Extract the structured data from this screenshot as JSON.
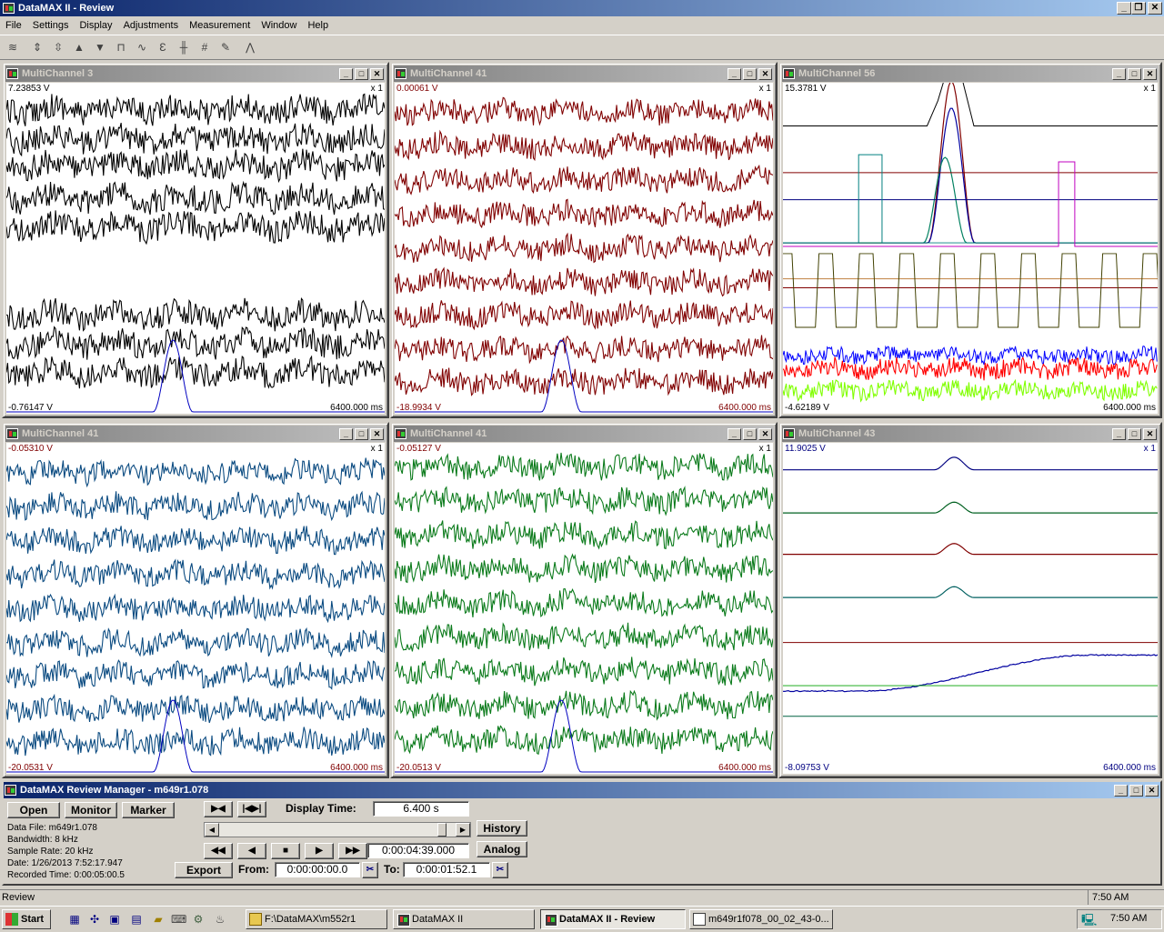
{
  "app": {
    "title": "DataMAX II - Review"
  },
  "menu": [
    "File",
    "Settings",
    "Display",
    "Adjustments",
    "Measurement",
    "Window",
    "Help"
  ],
  "toolbar_icons": [
    "waveform-icon",
    "zoom-in-vertical-icon",
    "zoom-out-vertical-icon",
    "arrow-up-icon",
    "arrow-down-icon",
    "chart-icon",
    "signal-icon",
    "eu-icon",
    "channel-icon",
    "grid-icon",
    "pen-icon",
    "trace-icon"
  ],
  "panels": [
    {
      "title": "MultiChannel 3",
      "top_value": "7.23853 V",
      "bottom_value": "-0.76147 V",
      "scale": "x 1",
      "time": "6400.000 ms",
      "color": "#000000"
    },
    {
      "title": "MultiChannel 41",
      "top_value": "0.00061 V",
      "bottom_value": "-18.9934 V",
      "scale": "x 1",
      "time": "6400.000 ms",
      "color": "#800000"
    },
    {
      "title": "MultiChannel 56",
      "top_value": "15.3781 V",
      "bottom_value": "-4.62189 V",
      "scale": "x 1",
      "time": "6400.000 ms",
      "color": "#000000"
    },
    {
      "title": "MultiChannel 41",
      "top_value": "-0.05310 V",
      "bottom_value": "-20.0531 V",
      "scale": "x 1",
      "time": "6400.000 ms",
      "color": "#800000"
    },
    {
      "title": "MultiChannel 41",
      "top_value": "-0.05127 V",
      "bottom_value": "-20.0513 V",
      "scale": "x 1",
      "time": "6400.000 ms",
      "color": "#800000"
    },
    {
      "title": "MultiChannel 43",
      "top_value": "11.9025 V",
      "bottom_value": "-8.09753 V",
      "scale": "x 1",
      "time": "6400.000 ms",
      "color": "#000080"
    }
  ],
  "manager": {
    "title": "DataMAX Review Manager - m649r1.078",
    "open": "Open",
    "monitor": "Monitor",
    "marker": "Marker",
    "export": "Export",
    "history": "History",
    "analog": "Analog",
    "display_time_label": "Display Time:",
    "display_time": "6.400 s",
    "position": "0:00:04:39.000",
    "from_label": "From:",
    "from": "0:00:00:00.0",
    "to_label": "To:",
    "to": "0:00:01:52.1",
    "data_file": "Data File: m649r1.078",
    "bandwidth": "Bandwidth: 8 kHz",
    "sample_rate": "Sample Rate: 20 kHz",
    "date": "Date: 1/26/2013   7:52:17.947",
    "recorded": "Recorded Time: 0:00:05:00.5"
  },
  "status": {
    "left": "Review",
    "time": "7:50 AM"
  },
  "taskbar": {
    "start": "Start",
    "tasks": [
      "F:\\DataMAX\\m552r1",
      "DataMAX II",
      "DataMAX II - Review",
      "m649r1f078_00_02_43-0..."
    ],
    "clock": "7:50 AM"
  }
}
